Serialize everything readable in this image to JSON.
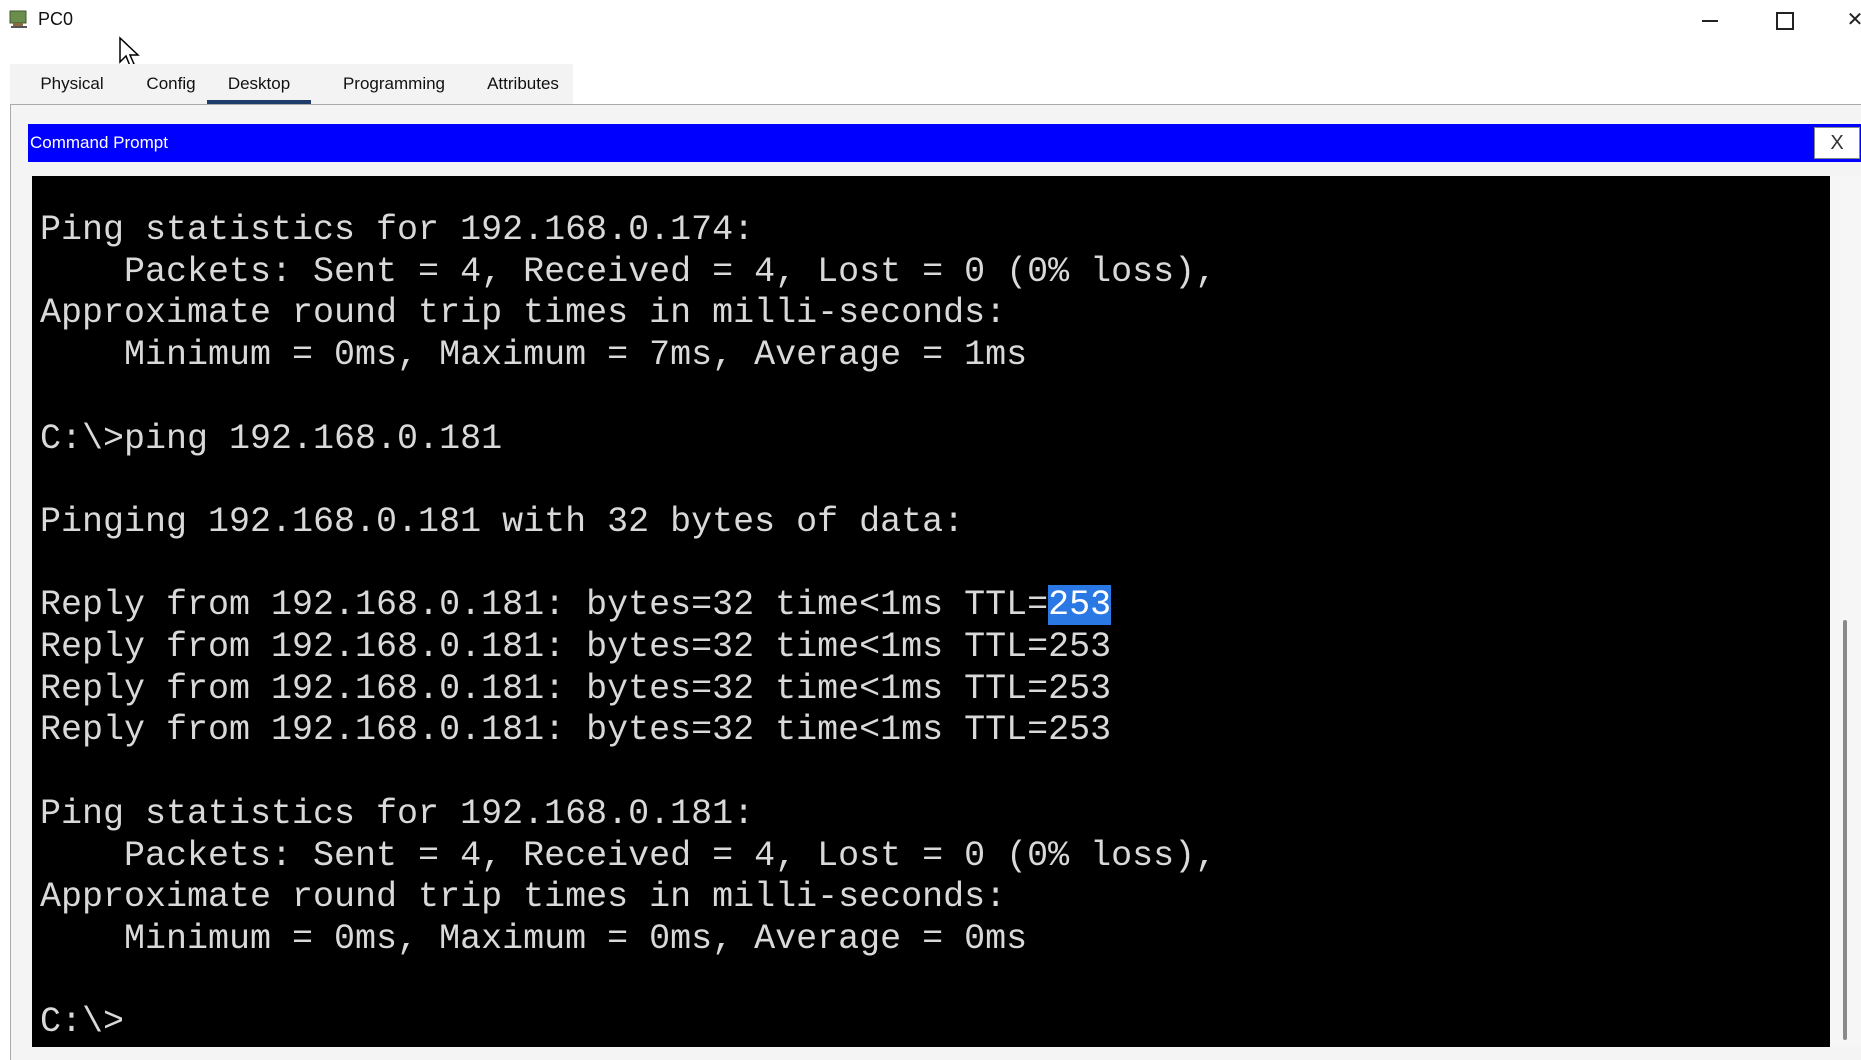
{
  "window": {
    "title": "PC0",
    "controls": {
      "minimize_icon": "minimize-icon",
      "maximize_icon": "maximize-icon",
      "close_icon": "close-icon"
    }
  },
  "tabs": [
    {
      "label": "Physical",
      "active": false
    },
    {
      "label": "Config",
      "active": false
    },
    {
      "label": "Desktop",
      "active": true
    },
    {
      "label": "Programming",
      "active": false
    },
    {
      "label": "Attributes",
      "active": false
    }
  ],
  "command_prompt": {
    "title": "Command Prompt",
    "close_label": "X",
    "lines": [
      "Ping statistics for 192.168.0.174:",
      "    Packets: Sent = 4, Received = 4, Lost = 0 (0% loss),",
      "Approximate round trip times in milli-seconds:",
      "    Minimum = 0ms, Maximum = 7ms, Average = 1ms",
      "",
      "C:\\>ping 192.168.0.181",
      "",
      "Pinging 192.168.0.181 with 32 bytes of data:",
      "",
      "Reply from 192.168.0.181: bytes=32 time<1ms TTL=253",
      "Reply from 192.168.0.181: bytes=32 time<1ms TTL=253",
      "Reply from 192.168.0.181: bytes=32 time<1ms TTL=253",
      "Reply from 192.168.0.181: bytes=32 time<1ms TTL=253",
      "",
      "Ping statistics for 192.168.0.181:",
      "    Packets: Sent = 4, Received = 4, Lost = 0 (0% loss),",
      "Approximate round trip times in milli-seconds:",
      "    Minimum = 0ms, Maximum = 0ms, Average = 0ms",
      "",
      "C:\\>"
    ],
    "selection": {
      "line": 9,
      "text": "253"
    }
  },
  "colors": {
    "header_bg": "#0000ff",
    "terminal_bg": "#000000",
    "terminal_fg": "#d9d9d9",
    "selection_bg": "#2a78e4",
    "active_tab_underline": "#1f3d6b"
  }
}
